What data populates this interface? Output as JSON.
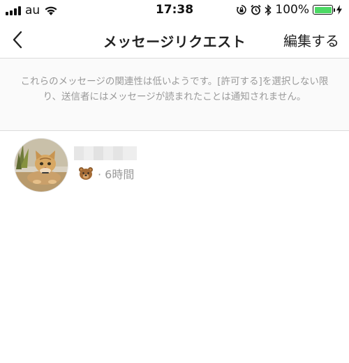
{
  "status_bar": {
    "carrier": "au",
    "time": "17:38",
    "battery_percent": "100%",
    "battery_level": 1.0,
    "icons": [
      "signal-bars-icon",
      "wifi-icon",
      "orientation-lock-icon",
      "alarm-icon",
      "bluetooth-icon",
      "battery-icon",
      "charging-bolt-icon"
    ]
  },
  "nav": {
    "title": "メッセージリクエスト",
    "edit_label": "編集する",
    "back_icon": "chevron-left-icon"
  },
  "notice": {
    "text": "これらのメッセージの関連性は低いようです。[許可する]を選択しない限り、送信者にはメッセージが読まれたことは通知されません。"
  },
  "requests": [
    {
      "sender_name": "",
      "message_icon": "bear-face-emoji-icon",
      "time_text": "· 6時間"
    }
  ],
  "colors": {
    "battery": "#4cd964",
    "muted_text": "#999999",
    "divider": "#dbdbdb",
    "banner_bg": "#fafafa"
  }
}
